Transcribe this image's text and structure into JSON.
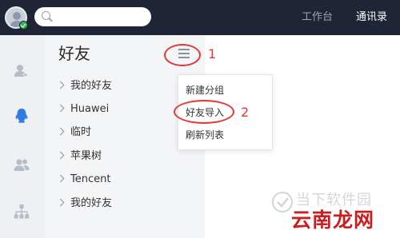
{
  "topbar": {
    "search_placeholder": "",
    "tabs": [
      {
        "label": "工作台",
        "active": false
      },
      {
        "label": "通讯录",
        "active": true
      }
    ]
  },
  "panel": {
    "title": "好友",
    "groups": [
      {
        "label": "我的好友"
      },
      {
        "label": "Huawei"
      },
      {
        "label": "临时"
      },
      {
        "label": "苹果树"
      },
      {
        "label": "Tencent"
      },
      {
        "label": "我的好友"
      }
    ]
  },
  "dropdown": {
    "items": [
      {
        "label": "新建分组"
      },
      {
        "label": "好友导入"
      },
      {
        "label": "刷新列表"
      }
    ]
  },
  "annotations": {
    "step1": "1",
    "step2": "2"
  },
  "watermark": {
    "top_text": "当下软件园",
    "bottom_text": "云南龙网"
  },
  "colors": {
    "topbar": "#1f2436",
    "accent_blue": "#2f7de1",
    "annotation_red": "#e53535",
    "online_green": "#2db84d"
  },
  "icons": [
    "search-icon",
    "add-friend-icon",
    "qq-penguin-icon",
    "group-icon",
    "org-chart-icon",
    "menu-icon",
    "chevron-right-icon"
  ]
}
